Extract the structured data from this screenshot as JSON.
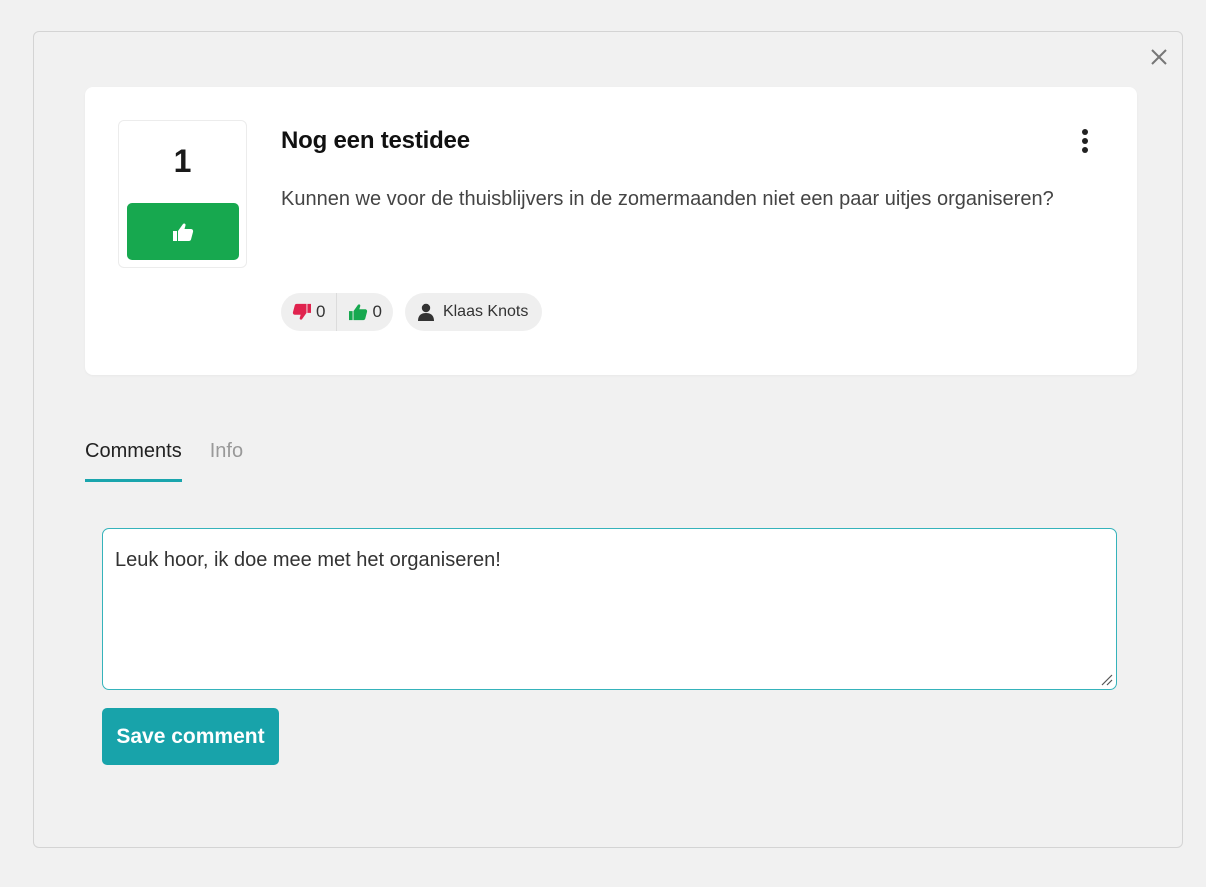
{
  "idea": {
    "vote_count": "1",
    "title": "Nog een testidee",
    "description": "Kunnen we voor de thuisblijvers in de zomermaanden niet een paar uitjes organiseren?",
    "downvotes": "0",
    "upvotes": "0",
    "author": "Klaas Knots"
  },
  "tabs": [
    {
      "label": "Comments",
      "active": true
    },
    {
      "label": "Info",
      "active": false
    }
  ],
  "comment": {
    "value": "Leuk hoor, ik doe mee met het organiseren!"
  },
  "actions": {
    "save_label": "Save comment"
  },
  "icons": {
    "close": "close-icon",
    "more": "kebab-menu-icon",
    "thumbs_up": "thumbs-up-icon",
    "thumbs_down": "thumbs-down-icon",
    "user": "user-icon"
  },
  "colors": {
    "upvote_green": "#17a84f",
    "downvote_red": "#e0234e",
    "accent_teal": "#18a3aa"
  }
}
